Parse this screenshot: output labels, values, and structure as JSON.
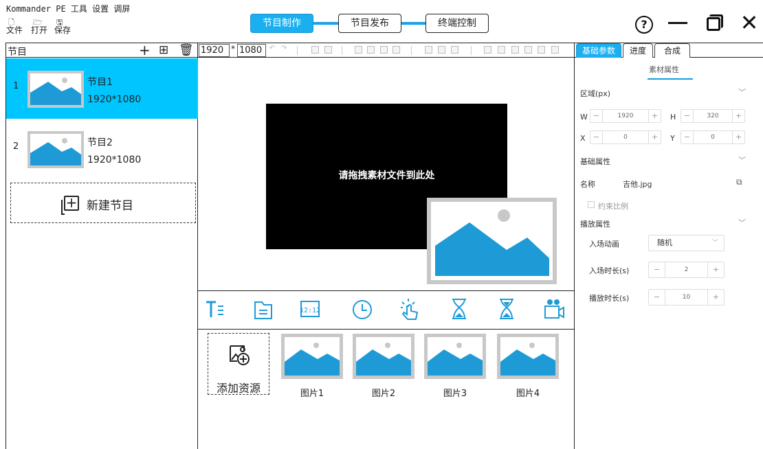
{
  "app": {
    "title": "Kommander PE 工具 设置 调屏",
    "menu": [
      {
        "icon": "🗋",
        "label": "文件"
      },
      {
        "icon": "🗁",
        "label": "打开"
      },
      {
        "icon": "🖫",
        "label": "保存"
      }
    ]
  },
  "mode_tabs": [
    {
      "label": "节目制作",
      "active": true
    },
    {
      "label": "节目发布",
      "active": false
    },
    {
      "label": "终端控制",
      "active": false
    }
  ],
  "window_controls": {
    "help": "?",
    "close": "✕"
  },
  "left_panel": {
    "title": "节目",
    "programs": [
      {
        "index": "1",
        "name": "节目1",
        "size": "1920*1080",
        "selected": true
      },
      {
        "index": "2",
        "name": "节目2",
        "size": "1920*1080",
        "selected": false
      }
    ],
    "new_program_label": "新建节目"
  },
  "toolbar": {
    "width": "1920",
    "separator": "*",
    "height": "1080"
  },
  "canvas": {
    "drop_hint": "请拖拽素材文件到此处"
  },
  "material_icons": [
    "text-icon",
    "folder-icon",
    "digital-clock-icon",
    "analog-clock-icon",
    "touch-icon",
    "timer-icon",
    "countdown-icon",
    "video-camera-icon"
  ],
  "resources": {
    "add_label": "添加资源",
    "items": [
      {
        "label": "图片1"
      },
      {
        "label": "图片2"
      },
      {
        "label": "图片3"
      },
      {
        "label": "图片4"
      }
    ]
  },
  "right_panel": {
    "tabs": [
      {
        "label": "基础参数",
        "active": true
      },
      {
        "label": "进度",
        "active": false
      },
      {
        "label": "合成",
        "active": false
      }
    ],
    "section_title": "素材属性",
    "region": {
      "title": "区域(px)",
      "w_label": "W",
      "w_value": "1920",
      "h_label": "H",
      "h_value": "320",
      "x_label": "X",
      "x_value": "0",
      "y_label": "Y",
      "y_value": "0"
    },
    "basic": {
      "title": "基础属性",
      "name_label": "名称",
      "name_value": "吉他.jpg",
      "aspect_label": "约束比例"
    },
    "play": {
      "title": "播放属性",
      "entry_anim_label": "入场动画",
      "entry_anim_value": "随机",
      "entry_dur_label": "入场时长(s)",
      "entry_dur_value": "2",
      "play_dur_label": "播放时长(s)",
      "play_dur_value": "10"
    }
  },
  "colors": {
    "accent": "#1ab0f0",
    "selected_row": "#00c6ff",
    "image_blue": "#1e9bd7",
    "image_frame": "#c8c8c8"
  }
}
